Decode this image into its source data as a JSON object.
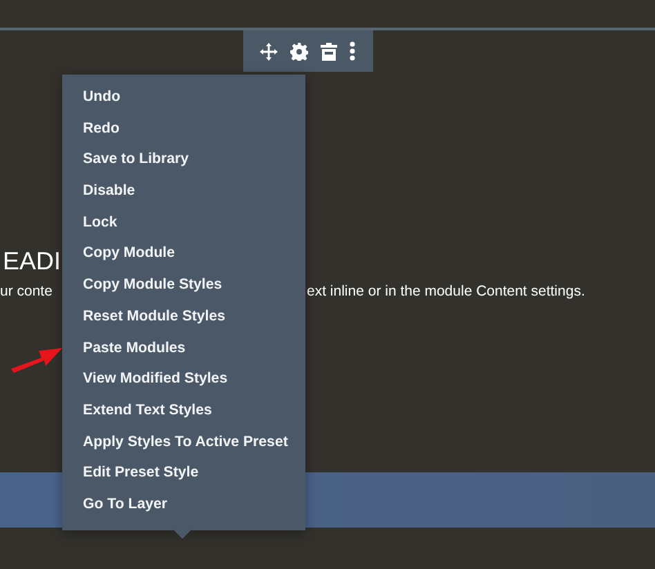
{
  "content": {
    "heading": "EADI",
    "text_fragments": [
      "ur conte",
      "ext inline or in the module Content settings."
    ]
  },
  "context_menu": {
    "items": [
      {
        "label": "Undo"
      },
      {
        "label": "Redo"
      },
      {
        "label": "Save to Library"
      },
      {
        "label": "Disable"
      },
      {
        "label": "Lock"
      },
      {
        "label": "Copy Module"
      },
      {
        "label": "Copy Module Styles"
      },
      {
        "label": "Reset Module Styles"
      },
      {
        "label": "Paste Modules"
      },
      {
        "label": "View Modified Styles"
      },
      {
        "label": "Extend Text Styles"
      },
      {
        "label": "Apply Styles To Active Preset"
      },
      {
        "label": "Edit Preset Style"
      },
      {
        "label": "Go To Layer"
      }
    ]
  }
}
